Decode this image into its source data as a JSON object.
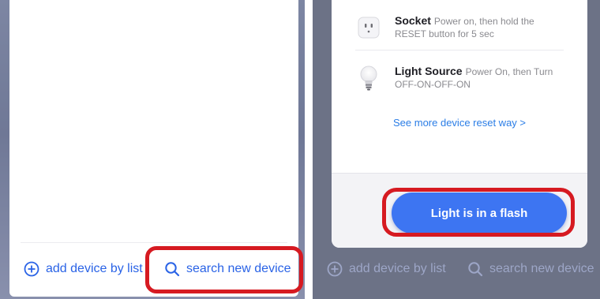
{
  "left_panel": {
    "add_by_list_label": "add device by list",
    "search_label": "search new device",
    "add_icon": "plus-circle-icon",
    "search_icon": "search-icon",
    "accent_color": "#2a63e6",
    "highlight_color": "#d61a21"
  },
  "right_panel": {
    "items": [
      {
        "name": "Socket",
        "instruction_line1": "Power on, then hold the",
        "instruction_line2": "RESET button for 5 sec",
        "icon": "socket-icon"
      },
      {
        "name": "Light Source",
        "instruction_line1": "Power On, then Turn",
        "instruction_line2": "OFF-ON-OFF-ON",
        "icon": "bulb-icon"
      }
    ],
    "more_link": "See more device reset way >",
    "flash_button_label": "Light is in a flash",
    "bottom_add_label": "add device by list",
    "bottom_search_label": "search new device",
    "button_color": "#3d75f2"
  }
}
